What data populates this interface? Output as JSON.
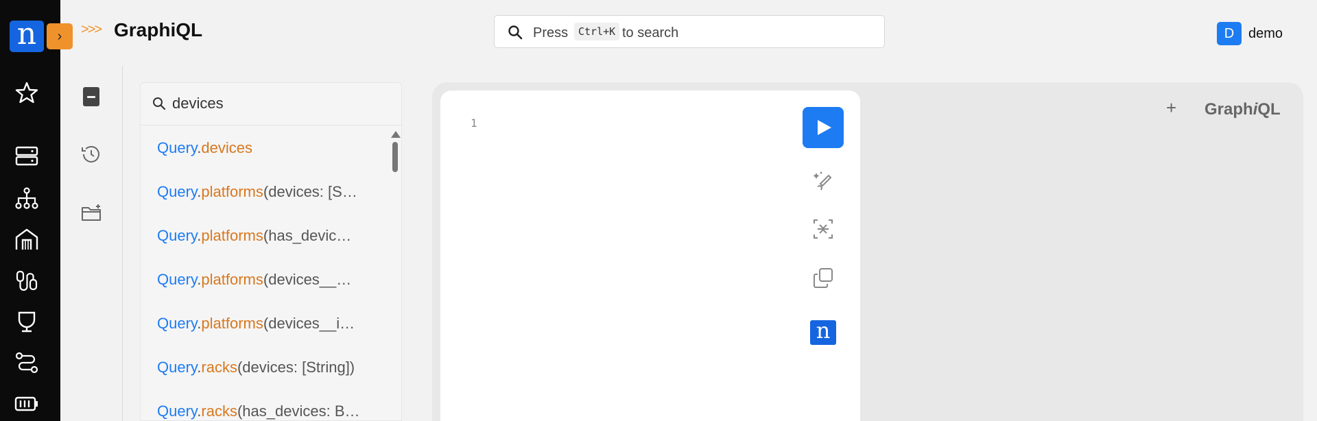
{
  "header": {
    "breadcrumb": ">>>",
    "title": "GraphiQL",
    "search": {
      "press": "Press",
      "shortcut": "Ctrl+K",
      "suffix": "to search"
    },
    "user": {
      "initial": "D",
      "name": "demo"
    }
  },
  "nav": {
    "logo": "n",
    "expand": "›",
    "items": [
      "star-icon",
      "server-icon",
      "hierarchy-icon",
      "building-icon",
      "cable-icon",
      "shield-icon",
      "routes-icon",
      "battery-icon"
    ]
  },
  "docs": {
    "search_value": "devices",
    "results": [
      {
        "type": "Query",
        "field": "devices",
        "args": ""
      },
      {
        "type": "Query",
        "field": "platforms",
        "args": "(devices: [S…"
      },
      {
        "type": "Query",
        "field": "platforms",
        "args": "(has_devic…"
      },
      {
        "type": "Query",
        "field": "platforms",
        "args": "(devices__…"
      },
      {
        "type": "Query",
        "field": "platforms",
        "args": "(devices__i…"
      },
      {
        "type": "Query",
        "field": "racks",
        "args": "(devices: [String])"
      },
      {
        "type": "Query",
        "field": "racks",
        "args": "(has_devices: B…"
      }
    ]
  },
  "editor": {
    "line_number": "1",
    "logo": "n"
  },
  "graphiql": {
    "plus": "+",
    "brand_a": "Graph",
    "brand_i": "i",
    "brand_b": "QL"
  },
  "colors": {
    "accent": "#1d7cf2",
    "field": "#d8781e",
    "nav": "#0b0b0b",
    "orange": "#f0922b"
  }
}
